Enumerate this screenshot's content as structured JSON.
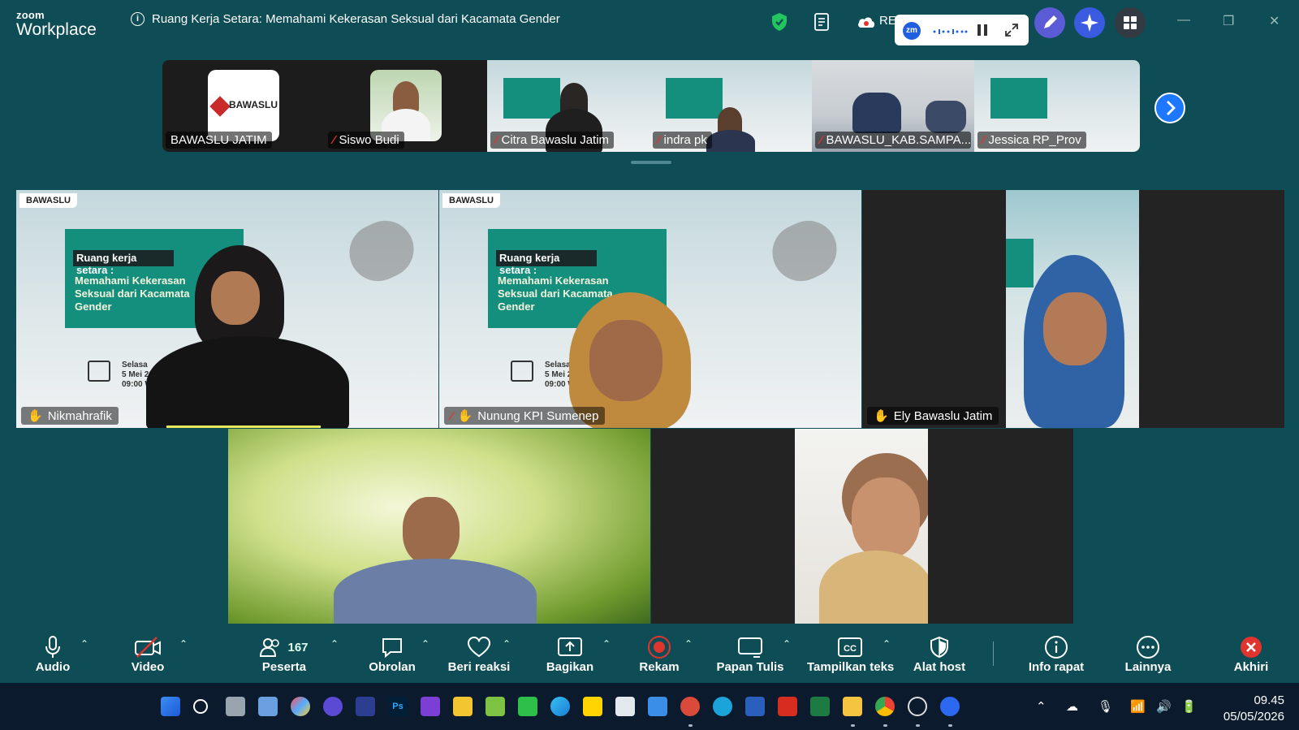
{
  "app": {
    "brand_line1": "zoom",
    "brand_line2": "Workplace",
    "meeting_title": "Ruang Kerja Setara: Memahami Kekerasan Seksual dari Kacamata Gender",
    "recording_label": "RE",
    "float_badge": "zm"
  },
  "thumbnails": [
    {
      "name": "BAWASLU JATIM",
      "muted": false,
      "logo_text": "BAWASLU"
    },
    {
      "name": "Siswo Budi",
      "muted": true
    },
    {
      "name": "Citra Bawaslu Jatim",
      "muted": true
    },
    {
      "name": "indra pk",
      "muted": true
    },
    {
      "name": "BAWASLU_KAB.SAMPA...",
      "muted": true
    },
    {
      "name": "Jessica RP_Prov",
      "muted": true
    }
  ],
  "slide": {
    "brand": "BAWASLU",
    "headline": "Ruang kerja setara :",
    "subtitle": "Memahami Kekerasan Seksual dari Kacamata Gender",
    "day": "Selasa",
    "date": "5 Mei 2026",
    "time": "09:00 WIB"
  },
  "tiles": [
    {
      "name": "Nikmahrafik",
      "muted": false,
      "speaking": true
    },
    {
      "name": "Nunung KPI Sumenep",
      "muted": true,
      "speaking": false
    },
    {
      "name": "Ely Bawaslu Jatim",
      "muted": false,
      "speaking": false
    },
    {
      "name": "",
      "muted": false,
      "speaking": false
    },
    {
      "name": "",
      "muted": false,
      "speaking": false
    }
  ],
  "toolbar": {
    "audio": "Audio",
    "video": "Video",
    "participants": "Peserta",
    "participant_count": "167",
    "chat": "Obrolan",
    "reactions": "Beri reaksi",
    "share": "Bagikan",
    "record": "Rekam",
    "whiteboard": "Papan Tulis",
    "captions": "Tampilkan teks",
    "host_tools": "Alat host",
    "info": "Info rapat",
    "more": "Lainnya",
    "end": "Akhiri"
  },
  "taskbar": {
    "time": "09.45",
    "date": "05/05/2026"
  },
  "colors": {
    "bg": "#0e4d55",
    "accent": "#1e78ff",
    "muted_red": "#e0352e",
    "record_red": "#e0352e",
    "speaking": "#e7e85a"
  }
}
